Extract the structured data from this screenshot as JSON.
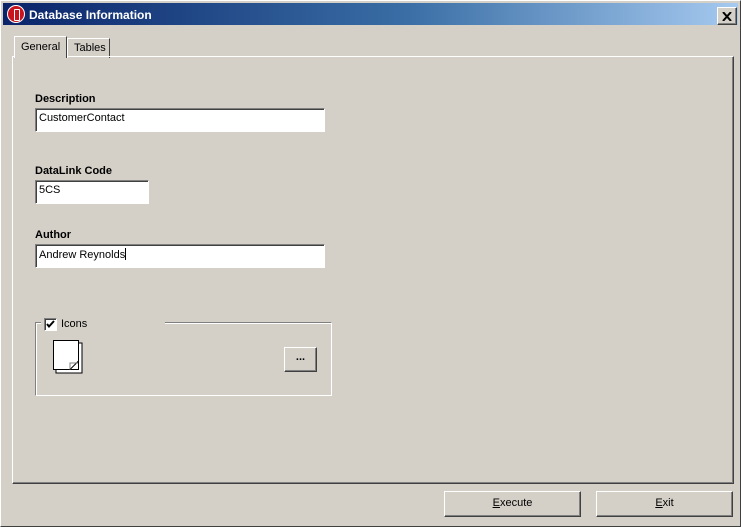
{
  "window": {
    "title": "Database Information",
    "close_label": "×"
  },
  "tabs": [
    {
      "label": "General",
      "active": true
    },
    {
      "label": "Tables",
      "active": false
    }
  ],
  "general": {
    "description": {
      "label": "Description",
      "value": "CustomerContact"
    },
    "datalink_code": {
      "label": "DataLink Code",
      "value": "5CS"
    },
    "author": {
      "label": "Author",
      "value": "Andrew Reynolds"
    },
    "icons_group": {
      "checkbox_label": "Icons",
      "checked": true,
      "icon": "document-icon",
      "browse_label": "..."
    }
  },
  "buttons": {
    "execute": {
      "mnemonic": "E",
      "rest": "xecute"
    },
    "exit": {
      "mnemonic": "E",
      "rest": "xit"
    }
  },
  "colors": {
    "face": "#d4d0c8",
    "title_start": "#0a246a",
    "title_end": "#a6caf0",
    "app_icon": "#c8141e"
  }
}
